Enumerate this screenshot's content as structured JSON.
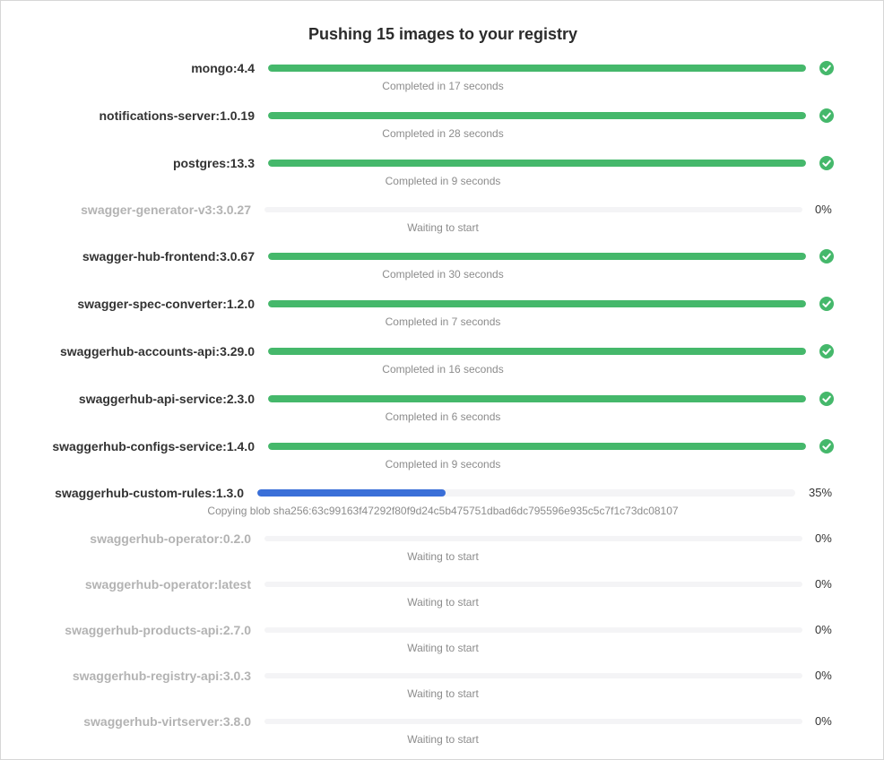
{
  "dialog": {
    "title": "Pushing 15 images to your registry"
  },
  "colors": {
    "completed": "#45b86b",
    "in_progress": "#3a6fd8",
    "track": "#f4f4f6"
  },
  "images": [
    {
      "name": "mongo:4.4",
      "state": "completed",
      "progress": 1.0,
      "status": "Completed in 17 seconds",
      "icon": "check-circle-icon"
    },
    {
      "name": "notifications-server:1.0.19",
      "state": "completed",
      "progress": 1.0,
      "status": "Completed in 28 seconds",
      "icon": "check-circle-icon"
    },
    {
      "name": "postgres:13.3",
      "state": "completed",
      "progress": 1.0,
      "status": "Completed in 9 seconds",
      "icon": "check-circle-icon"
    },
    {
      "name": "swagger-generator-v3:3.0.27",
      "state": "waiting",
      "progress": 0,
      "percent": "0%",
      "status": "Waiting to start"
    },
    {
      "name": "swagger-hub-frontend:3.0.67",
      "state": "completed",
      "progress": 1.0,
      "status": "Completed in 30 seconds",
      "icon": "check-circle-icon"
    },
    {
      "name": "swagger-spec-converter:1.2.0",
      "state": "completed",
      "progress": 1.0,
      "status": "Completed in 7 seconds",
      "icon": "check-circle-icon"
    },
    {
      "name": "swaggerhub-accounts-api:3.29.0",
      "state": "completed",
      "progress": 1.0,
      "status": "Completed in 16 seconds",
      "icon": "check-circle-icon"
    },
    {
      "name": "swaggerhub-api-service:2.3.0",
      "state": "completed",
      "progress": 1.0,
      "status": "Completed in 6 seconds",
      "icon": "check-circle-icon"
    },
    {
      "name": "swaggerhub-configs-service:1.4.0",
      "state": "completed",
      "progress": 1.0,
      "status": "Completed in 9 seconds",
      "icon": "check-circle-icon"
    },
    {
      "name": "swaggerhub-custom-rules:1.3.0",
      "state": "in_progress",
      "progress": 0.35,
      "percent": "35%",
      "status": "Copying blob sha256:63c99163f47292f80f9d24c5b475751dbad6dc795596e935c5c7f1c73dc08107"
    },
    {
      "name": "swaggerhub-operator:0.2.0",
      "state": "waiting",
      "progress": 0,
      "percent": "0%",
      "status": "Waiting to start"
    },
    {
      "name": "swaggerhub-operator:latest",
      "state": "waiting",
      "progress": 0,
      "percent": "0%",
      "status": "Waiting to start"
    },
    {
      "name": "swaggerhub-products-api:2.7.0",
      "state": "waiting",
      "progress": 0,
      "percent": "0%",
      "status": "Waiting to start"
    },
    {
      "name": "swaggerhub-registry-api:3.0.3",
      "state": "waiting",
      "progress": 0,
      "percent": "0%",
      "status": "Waiting to start"
    },
    {
      "name": "swaggerhub-virtserver:3.8.0",
      "state": "waiting",
      "progress": 0,
      "percent": "0%",
      "status": "Waiting to start"
    }
  ]
}
